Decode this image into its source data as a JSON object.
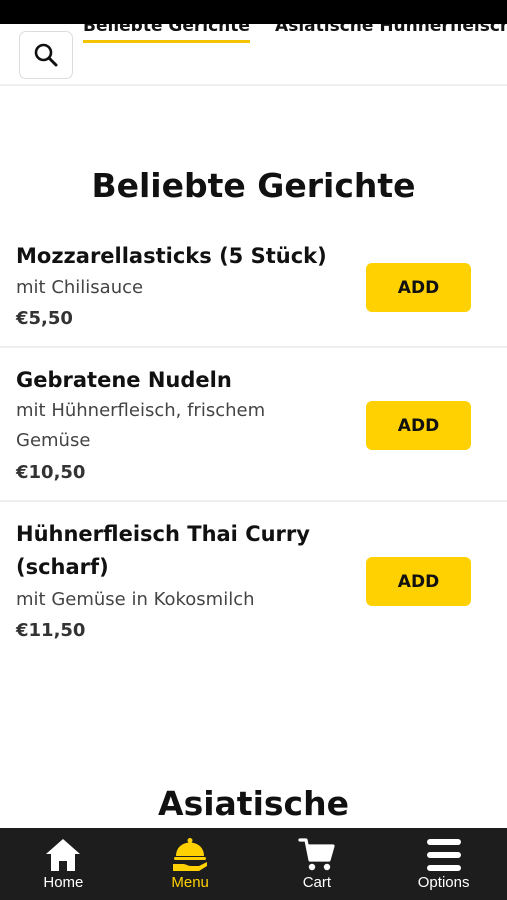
{
  "categories": [
    {
      "label": "Beliebte Gerichte",
      "active": true
    },
    {
      "label": "Asiatische Hühnerfleisch"
    }
  ],
  "sections": [
    {
      "title": "Beliebte Gerichte",
      "items": [
        {
          "name": "Mozzarellasticks (5 Stück)",
          "description": "mit Chilisauce",
          "price": "€5,50",
          "button": "ADD"
        },
        {
          "name": "Gebratene Nudeln",
          "description_lines": [
            "mit Hühnerfleisch, frischem",
            "Gemüse"
          ],
          "price": "€10,50",
          "button": "ADD"
        },
        {
          "name_lines": [
            "Hühnerfleisch Thai Curry",
            "(scharf)"
          ],
          "description": "mit Gemüse in Kokosmilch",
          "price": "€11,50",
          "button": "ADD"
        }
      ]
    },
    {
      "title": "Asiatische"
    }
  ],
  "bottom_nav": [
    {
      "label": "Home",
      "icon": "home-icon"
    },
    {
      "label": "Menu",
      "icon": "food-serving-icon",
      "active": true
    },
    {
      "label": "Cart",
      "icon": "cart-icon"
    },
    {
      "label": "Options",
      "icon": "menu-icon"
    }
  ],
  "colors": {
    "accent": "#ffd100",
    "nav_bg": "#1d1d1d"
  }
}
